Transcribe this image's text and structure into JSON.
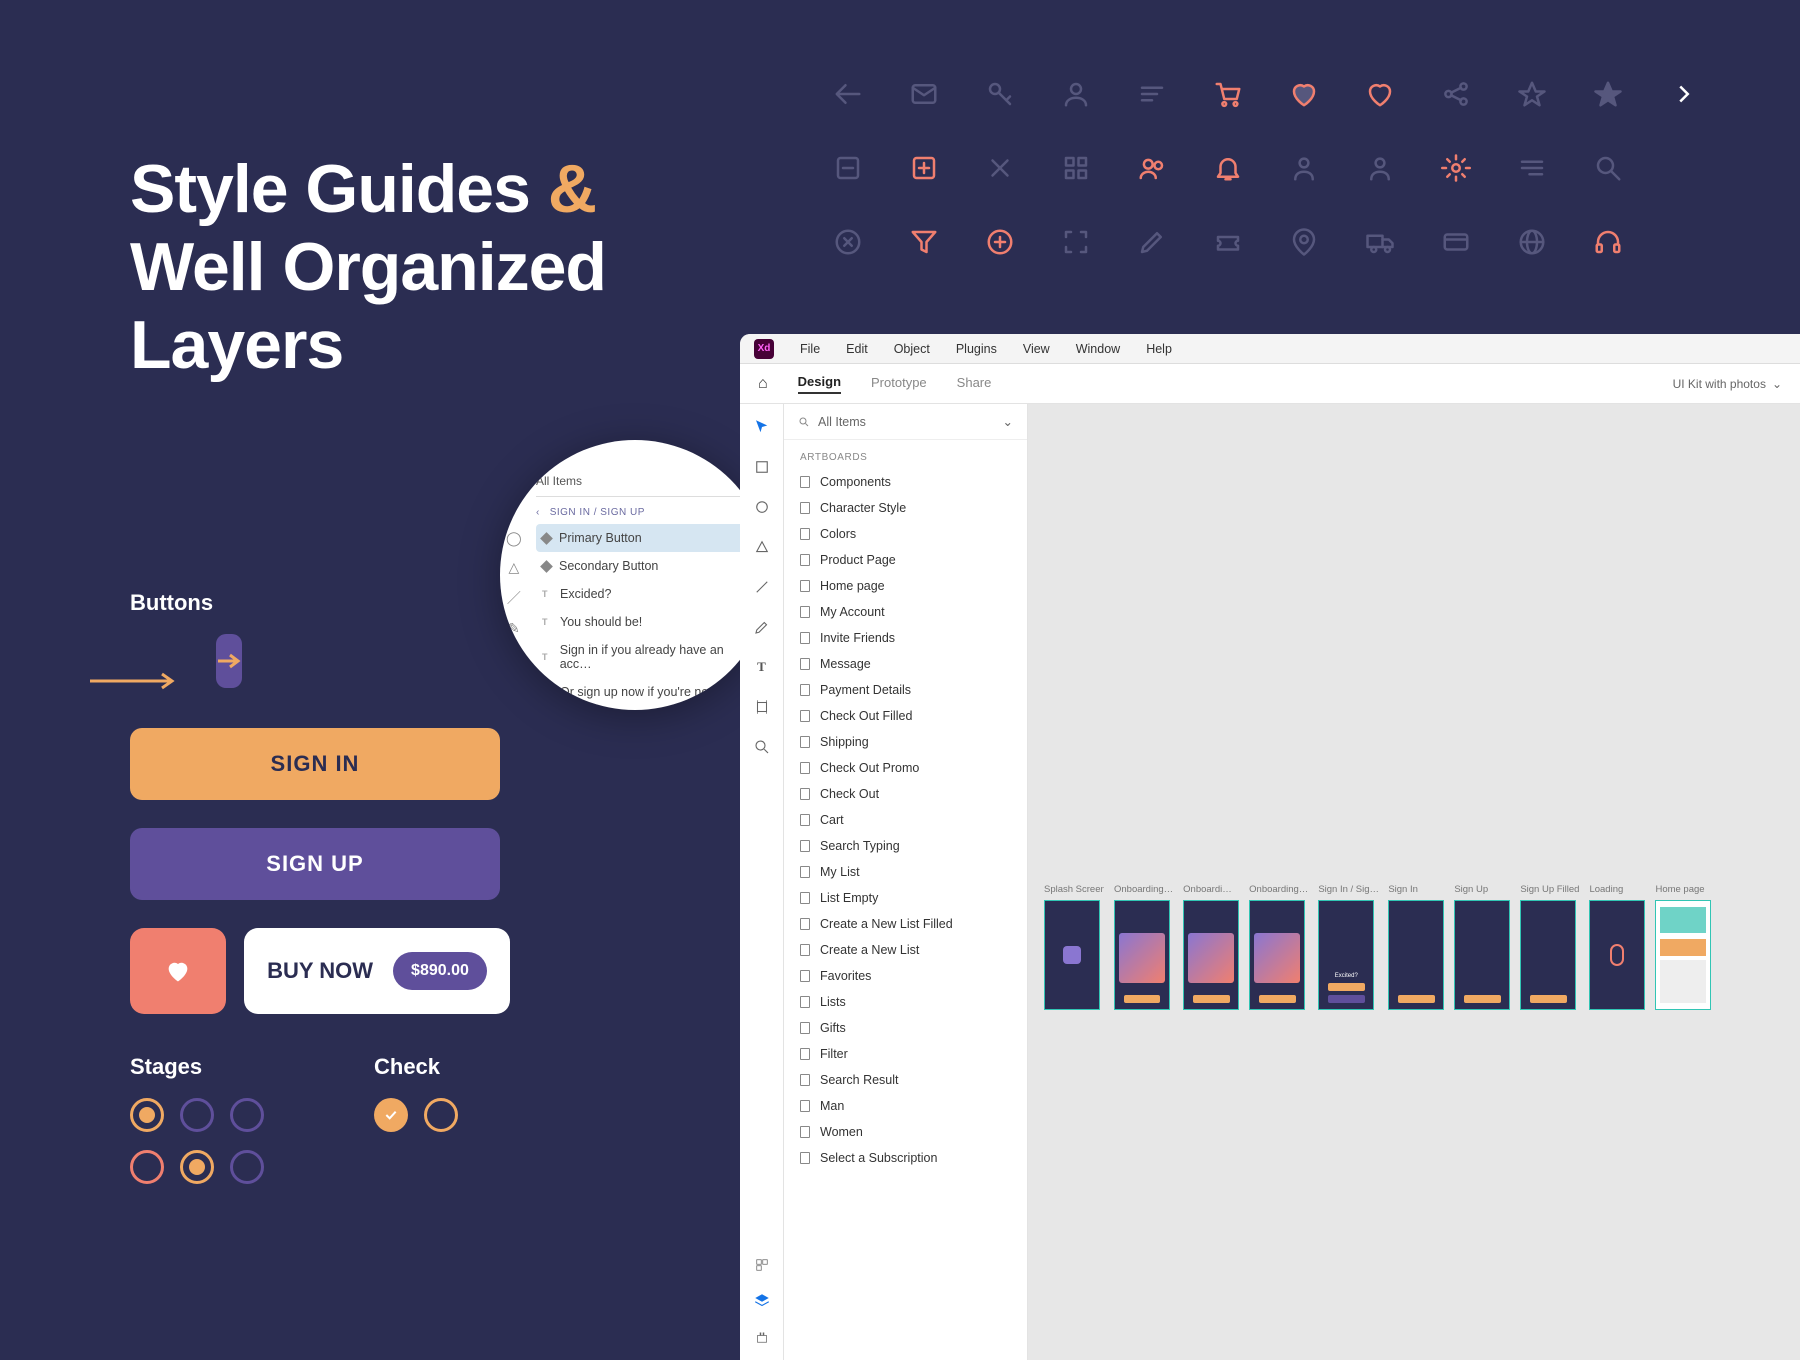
{
  "hero": {
    "line1": "Style Guides",
    "amp": "&",
    "line2": "Well Organized",
    "line3": "Layers"
  },
  "sections": {
    "buttons": "Buttons",
    "stages": "Stages",
    "check": "Check"
  },
  "buttons": {
    "signin": "SIGN IN",
    "signup": "SIGN UP",
    "buy_now": "BUY NOW",
    "price": "$890.00"
  },
  "bubble": {
    "filter": "All Items",
    "crumb_back": "‹",
    "crumb": "SIGN IN / SIGN UP",
    "layers": [
      {
        "type": "obj",
        "label": "Primary Button",
        "sel": true
      },
      {
        "type": "obj",
        "label": "Secondary Button"
      },
      {
        "type": "text",
        "label": "Excided?"
      },
      {
        "type": "text",
        "label": "You should be!"
      },
      {
        "type": "text",
        "label": "Sign in if you already have an acc…"
      },
      {
        "type": "text",
        "label": "Or sign up now if you're new"
      }
    ]
  },
  "xd": {
    "menubar": [
      "File",
      "Edit",
      "Object",
      "Plugins",
      "View",
      "Window",
      "Help"
    ],
    "tabs": {
      "home": "⌂",
      "design": "Design",
      "prototype": "Prototype",
      "share": "Share"
    },
    "filename": "UI Kit with photos",
    "panel": {
      "search_label": "All Items",
      "section": "ARTBOARDS",
      "artboards": [
        "Components",
        "Character Style",
        "Colors",
        "Product Page",
        "Home page",
        "My Account",
        "Invite Friends",
        "Message",
        "Payment Details",
        "Check Out Filled",
        "Shipping",
        "Check Out Promo",
        "Check Out",
        "Cart",
        "Search Typing",
        "My List",
        "List Empty",
        "Create a New List Filled",
        "Create a New List",
        "Favorites",
        "Lists",
        "Gifts",
        "Filter",
        "Search Result",
        "Man",
        "Women",
        "Select a Subscription"
      ]
    },
    "thumbs": [
      "Splash Screen",
      "Onboarding…",
      "Onboardi…",
      "Onboarding…",
      "Sign In / Sig…",
      "Sign In",
      "Sign Up",
      "Sign Up Filled",
      "Loading",
      "Home page"
    ]
  },
  "icon_grid": [
    [
      "arrow-left",
      "mail",
      "key",
      "user",
      "text-left",
      "cart",
      "heart-fill",
      "heart",
      "share",
      "star",
      "star-fill"
    ],
    [
      "minus-square",
      "plus-square",
      "close",
      "grid",
      "users",
      "bell",
      "person",
      "person-outline",
      "gear",
      "list",
      "search"
    ],
    [
      "close-circle",
      "funnel",
      "plus-circle",
      "scan",
      "edit",
      "ticket",
      "pin",
      "truck",
      "card",
      "globe",
      "headphones"
    ]
  ],
  "icon_grid_highlights": [
    "cart",
    "heart-fill",
    "heart",
    "plus-square",
    "users",
    "bell",
    "gear",
    "funnel",
    "plus-circle",
    "headphones"
  ],
  "icon_grid_trail_chevron": true
}
